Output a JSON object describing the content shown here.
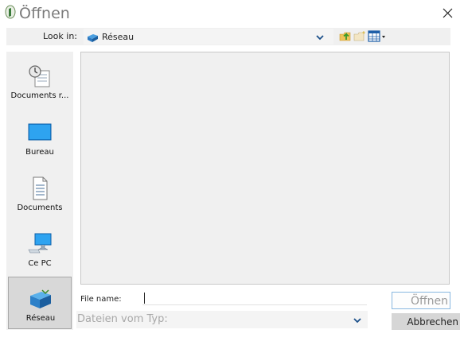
{
  "window": {
    "title": "Öffnen"
  },
  "lookin": {
    "label": "Look in:",
    "value": "Réseau"
  },
  "places": [
    {
      "label": "Documents r..."
    },
    {
      "label": "Bureau"
    },
    {
      "label": "Documents"
    },
    {
      "label": "Ce PC"
    },
    {
      "label": "Réseau"
    }
  ],
  "filename": {
    "label": "File name:",
    "value": ""
  },
  "filetype": {
    "label": "Dateien vom Typ:"
  },
  "buttons": {
    "open": "Öffnen",
    "cancel": "Abbrechen"
  },
  "colors": {
    "accent": "#1e7fd6",
    "panel": "#f0f0f0"
  }
}
